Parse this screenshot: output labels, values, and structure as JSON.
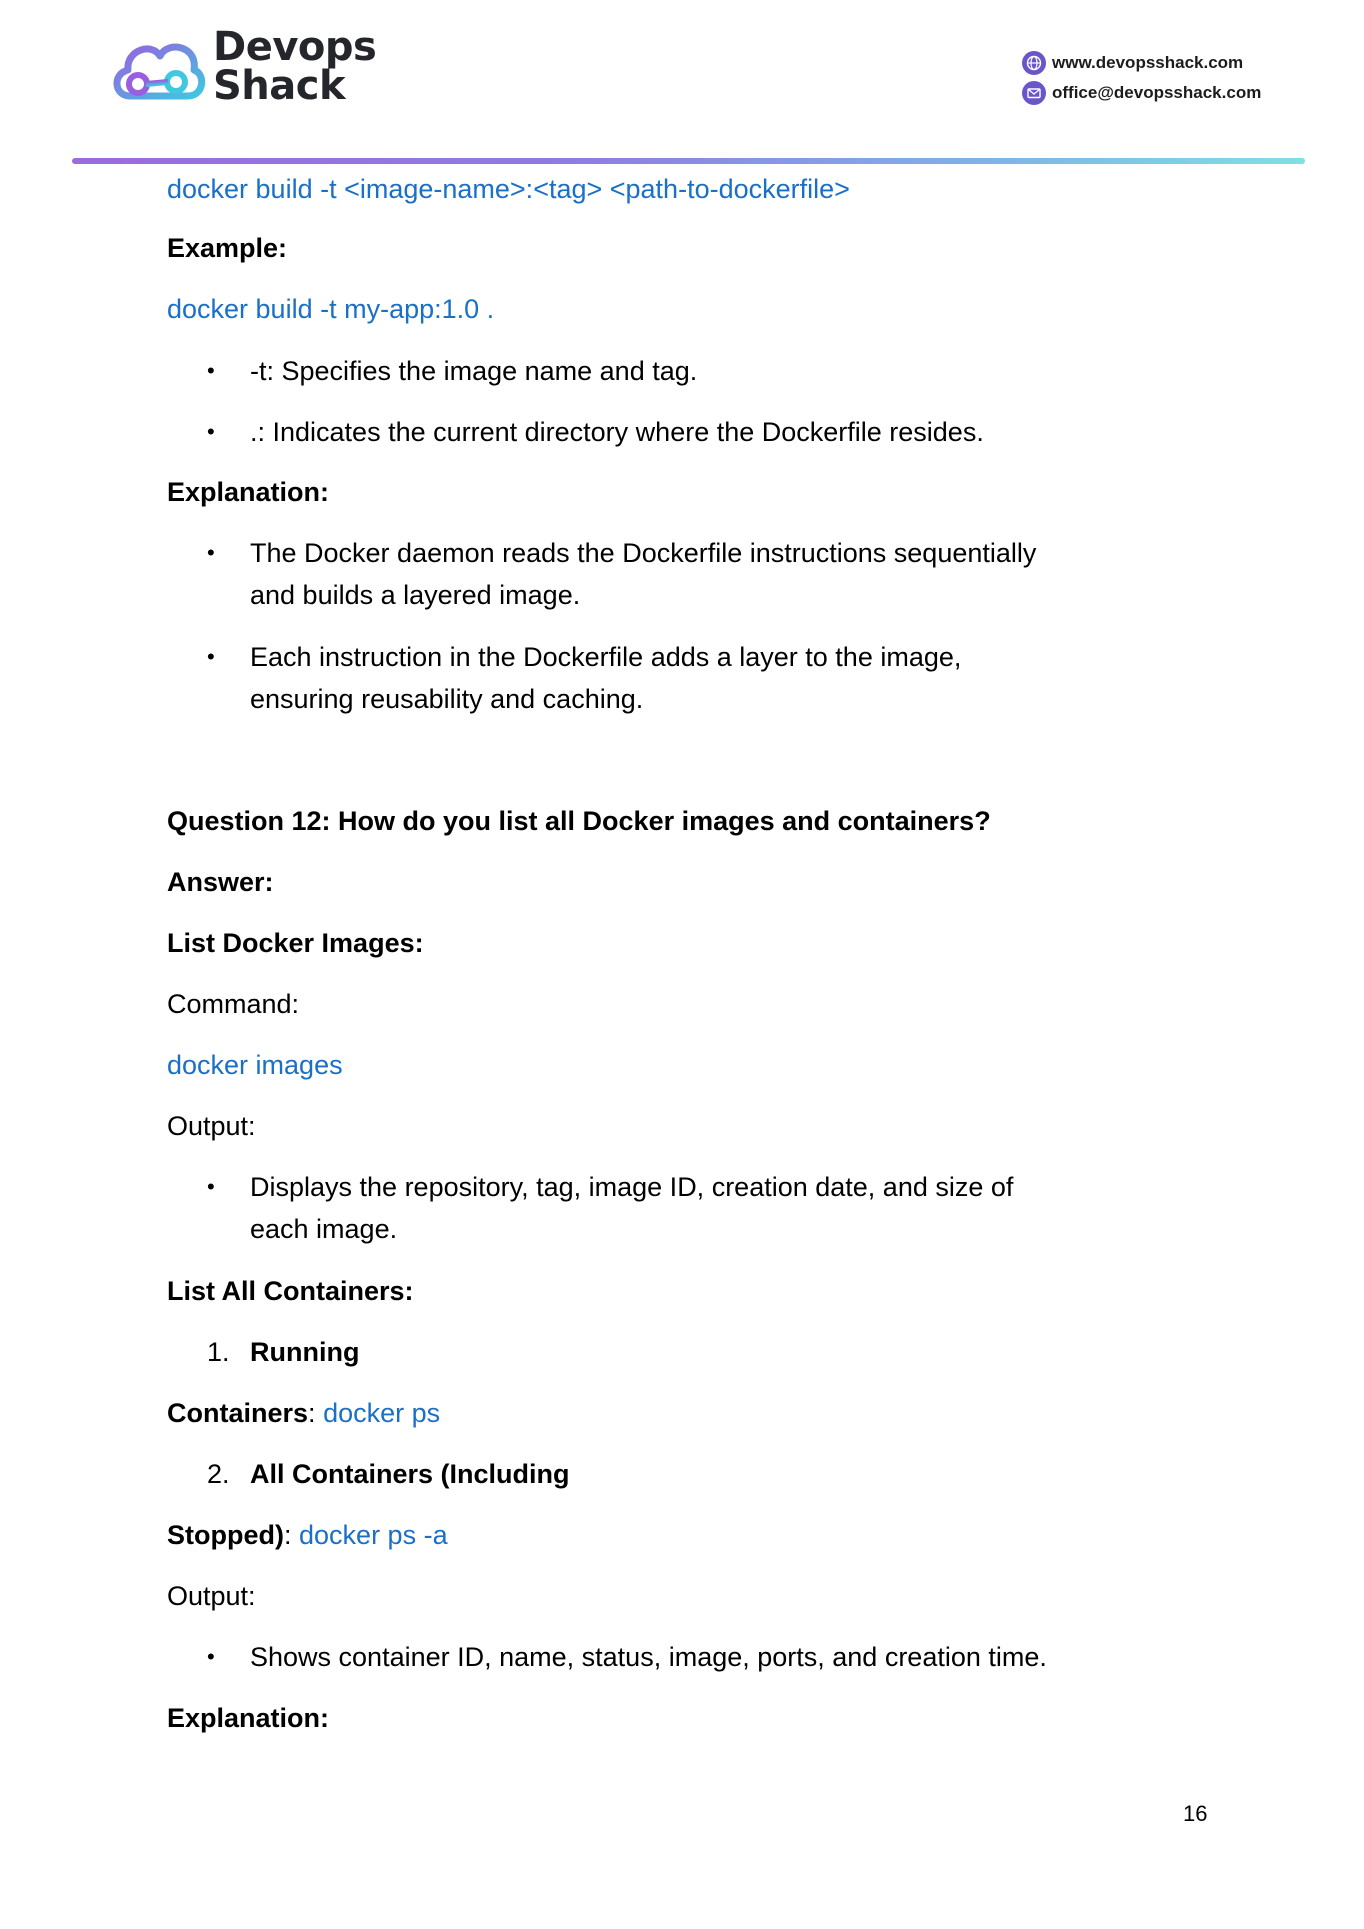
{
  "header": {
    "logo_line1": "Devops",
    "logo_line2": "Shack",
    "website": "www.devopsshack.com",
    "email": "office@devopsshack.com",
    "accent_colors": [
      "#9b6be0",
      "#7fe0e3"
    ]
  },
  "content": {
    "build_syntax": "docker build -t <image-name>:<tag> <path-to-dockerfile>",
    "example_heading": "Example:",
    "example_cmd": "docker build -t my-app:1.0 .",
    "example_points": [
      "-t: Specifies the image name and tag.",
      ".: Indicates the current directory where the Dockerfile resides."
    ],
    "explanation_heading": "Explanation:",
    "explanation_points": [
      [
        "The Docker daemon reads the Dockerfile instructions sequentially",
        "and builds a layered image."
      ],
      [
        "Each instruction in the Dockerfile adds a layer to the image,",
        "ensuring reusability and caching."
      ]
    ],
    "question": "Question 12: How do you list all Docker images and containers?",
    "answer_heading": "Answer:",
    "list_images_heading": "List Docker Images:",
    "command_label": "Command:",
    "images_cmd": "docker images",
    "output_label": "Output:",
    "images_output": [
      "Displays the repository, tag, image ID, creation date, and size of",
      "each image."
    ],
    "list_containers_heading": "List All Containers:",
    "item1_num": "1.",
    "item1_label": "Running",
    "containers_label": "Containers",
    "colon": ":",
    "ps_cmd": "docker ps",
    "item2_num": "2.",
    "item2_label": "All Containers (Including",
    "stopped_label": "Stopped)",
    "ps_a_cmd": "docker ps -a",
    "output_label2": "Output:",
    "containers_output": "Shows container ID, name, status, image, ports, and creation time.",
    "explanation_heading2": "Explanation:",
    "bullet": "•"
  },
  "footer": {
    "page_number": "16"
  }
}
